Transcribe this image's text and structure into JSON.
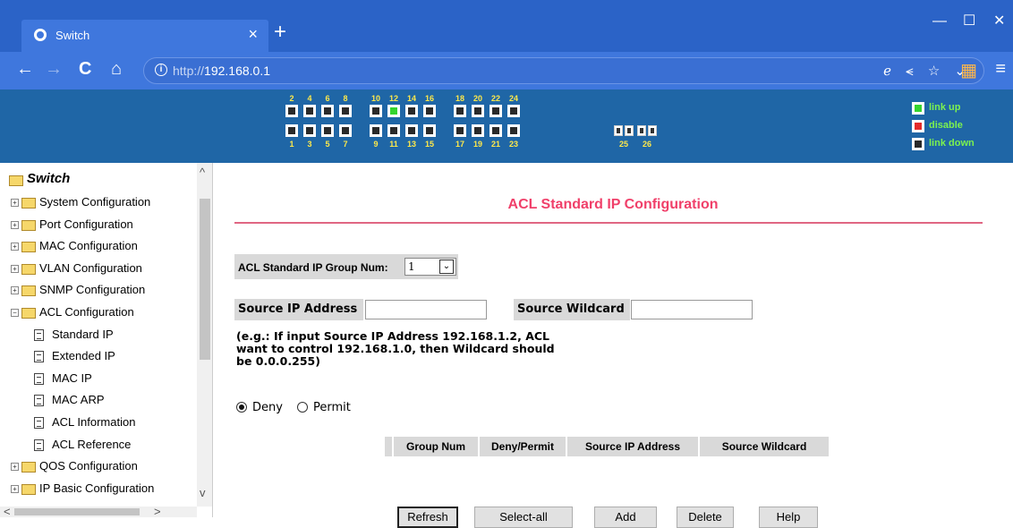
{
  "browser": {
    "tab_title": "Switch",
    "tab_close": "×",
    "new_tab": "+",
    "url_scheme": "http://",
    "url_host": "192.168.0.1",
    "url_info_icon": "i",
    "nav": {
      "back": "←",
      "forward": "→",
      "reload": "C",
      "home": "⌂"
    },
    "url_action_icons": "ℯ ⪪ ☆ ⌄",
    "window": {
      "minimize": "—",
      "maximize": "☐",
      "close": "✕"
    },
    "menu_glyph": "≡",
    "apps_glyph": "▦"
  },
  "device": {
    "top_port_numbers": [
      "2",
      "4",
      "6",
      "8",
      "10",
      "12",
      "14",
      "16",
      "18",
      "20",
      "22",
      "24"
    ],
    "bottom_port_numbers": [
      "1",
      "3",
      "5",
      "7",
      "9",
      "11",
      "13",
      "15",
      "17",
      "19",
      "21",
      "23"
    ],
    "sfp_port_numbers": [
      "25",
      "26"
    ],
    "port_up": "12",
    "legend": {
      "up": "link up",
      "disable": "disable",
      "down": "link down"
    },
    "colors": {
      "up": "#35d52e",
      "disable": "#e42b2b",
      "down": "#2a2a2a",
      "panel": "#1f66a6"
    }
  },
  "sidebar": {
    "root": "Switch",
    "items": [
      "System Configuration",
      "Port Configuration",
      "MAC Configuration",
      "VLAN Configuration",
      "SNMP Configuration",
      "ACL Configuration"
    ],
    "acl_children": [
      "Standard IP",
      "Extended IP",
      "MAC IP",
      "MAC ARP",
      "ACL Information",
      "ACL Reference"
    ],
    "items_after": [
      "QOS Configuration",
      "IP Basic Configuration"
    ],
    "expand_plus": "+",
    "expand_minus": "−",
    "scroll_up": "^",
    "scroll_down": "v",
    "scroll_left": "<",
    "scroll_right": ">"
  },
  "main": {
    "title": "ACL Standard IP Configuration",
    "group_label": "ACL Standard IP Group Num:",
    "group_value": "1",
    "select_arrow": "⌄",
    "source_ip_label": "Source IP Address",
    "source_wildcard_label": "Source Wildcard",
    "source_ip_value": "",
    "source_wildcard_value": "",
    "hint_line1": "(e.g.: If input Source IP Address 192.168.1.2, ACL",
    "hint_line2": "want to control 192.168.1.0, then Wildcard should",
    "hint_line3": "be 0.0.0.255)",
    "radio_deny": "Deny",
    "radio_permit": "Permit",
    "radio_selected": "Deny",
    "table_headers": [
      "Group Num",
      "Deny/Permit",
      "Source IP Address",
      "Source Wildcard"
    ],
    "buttons": {
      "refresh": "Refresh",
      "select_all": "Select-all",
      "add": "Add",
      "delete": "Delete",
      "help": "Help"
    },
    "accent": "#f0406a"
  }
}
